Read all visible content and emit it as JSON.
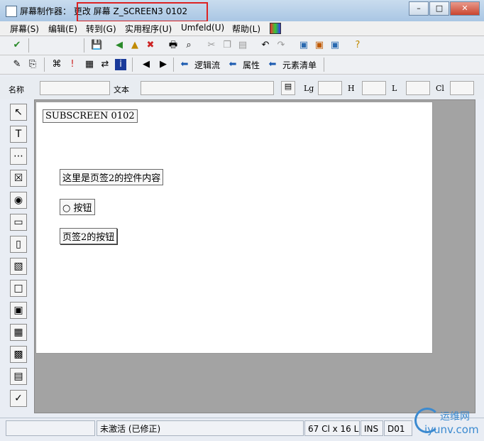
{
  "window": {
    "title_prefix": "屏幕制作器：",
    "title_action": "更改 屏幕 Z_SCREEN3 0102",
    "btn_minimize": "–",
    "btn_maximize": "□",
    "btn_close": "✕"
  },
  "menu": [
    "屏幕(S)",
    "编辑(E)",
    "转到(G)",
    "实用程序(U)",
    "Umfeld(U)",
    "帮助(L)"
  ],
  "toolbar2": {
    "logic_flow": "逻辑流",
    "attributes": "属性",
    "element_list": "元素清单"
  },
  "fields": {
    "name_label": "名称",
    "text_label": "文本",
    "lg_label": "Lg",
    "h_label": "H",
    "l_label": "L",
    "cl_label": "Cl"
  },
  "canvas": {
    "subscreen": "SUBSCREEN 0102",
    "text_label": "这里是页签2的控件内容",
    "radio_label": "按钮",
    "push_button": "页签2的按钮"
  },
  "status": {
    "state": "未激活 (已修正)",
    "size": "67 Cl x 16 L",
    "mode": "INS",
    "system": "D01"
  },
  "watermark": {
    "text": "运维网",
    "url": "iyunv.com"
  }
}
